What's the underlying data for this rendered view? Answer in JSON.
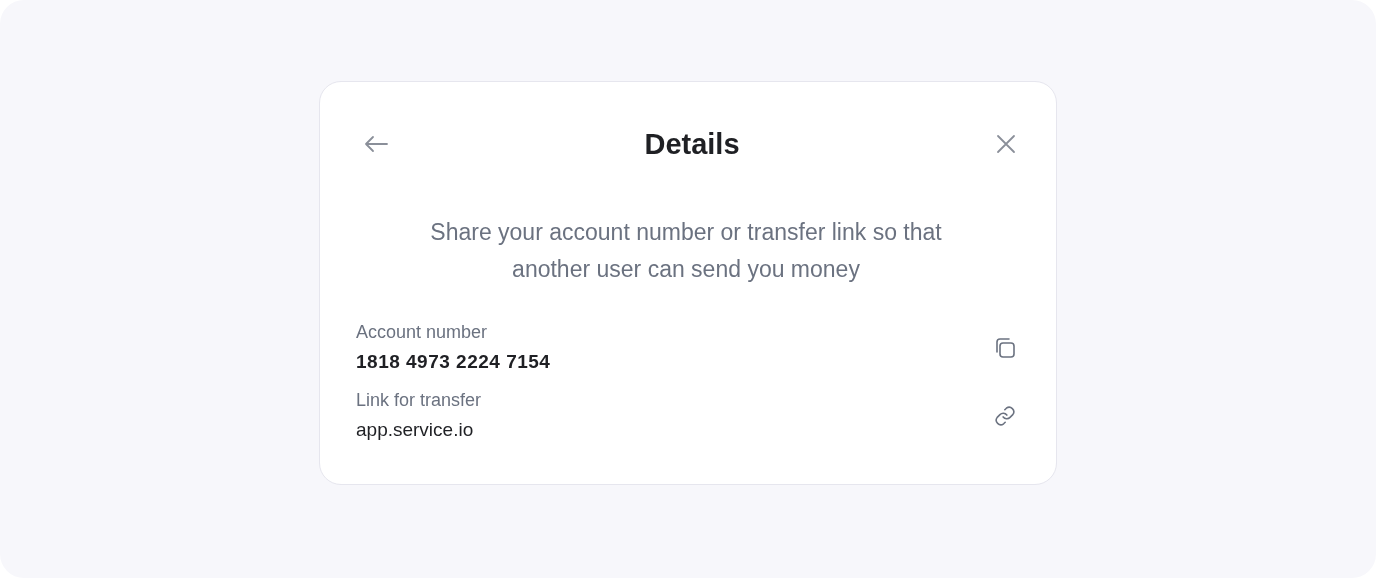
{
  "dialog": {
    "title": "Details",
    "description": "Share your account number or transfer link so that another user can send you money"
  },
  "fields": [
    {
      "kind": "account",
      "label": "Account number",
      "value": "1818 4973 2224 7154"
    },
    {
      "kind": "link",
      "label": "Link for transfer",
      "value": "app.service.io"
    }
  ]
}
